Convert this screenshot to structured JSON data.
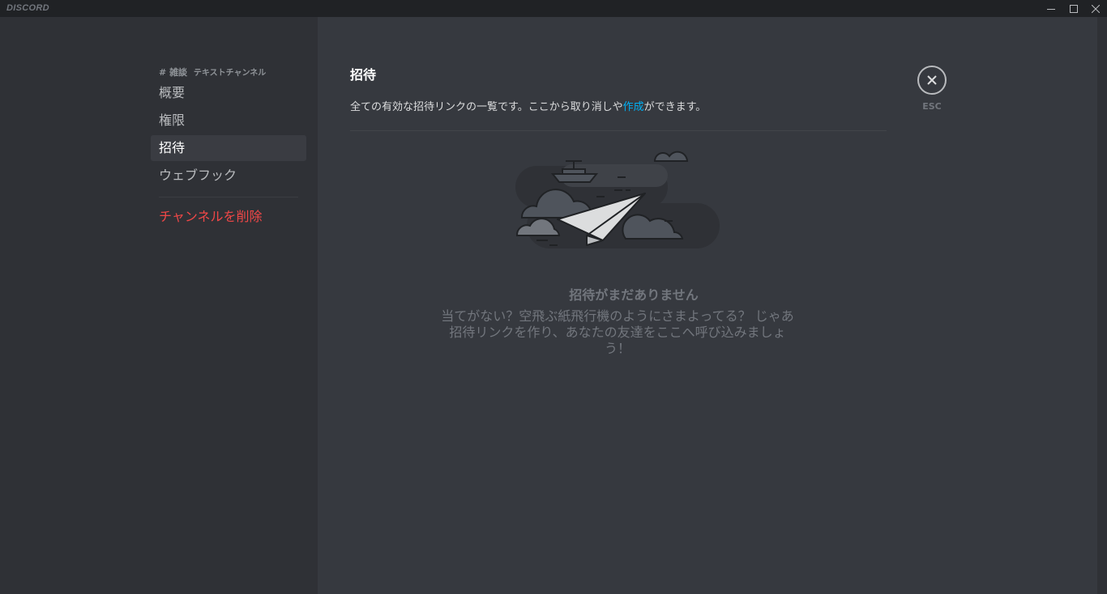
{
  "titlebar": {
    "brand": "DISCORD",
    "minimize_icon": "minimize-icon",
    "maximize_icon": "maximize-icon",
    "close_icon": "close-icon"
  },
  "sidebar": {
    "header": {
      "hash": "#",
      "channel_name": "雑談",
      "channel_type": "テキストチャンネル"
    },
    "items": [
      {
        "label": "概要",
        "active": false
      },
      {
        "label": "権限",
        "active": false
      },
      {
        "label": "招待",
        "active": true
      },
      {
        "label": "ウェブフック",
        "active": false
      }
    ],
    "delete_label": "チャンネルを削除"
  },
  "main": {
    "title": "招待",
    "description_before": "全ての有効な招待リンクの一覧です。ここから取り消しや",
    "description_link": "作成",
    "description_after": "ができます。",
    "close_icon": "close-circle-icon",
    "esc_label": "ESC",
    "empty_state": {
      "illustration": "paper-airplane-clouds-illustration",
      "title": "招待がまだありません",
      "body": "当てがない？空飛ぶ紙飛行機のようにさまよってる？ じゃあ招待リンクを作り、あなたの友達をここへ呼び込みましょう！"
    }
  },
  "colors": {
    "titlebar": "#202225",
    "sidebar": "#2f3136",
    "content": "#36393f",
    "active_item": "#3a3c42",
    "danger": "#f04747",
    "link": "#00b0f4",
    "muted": "#72767d"
  }
}
